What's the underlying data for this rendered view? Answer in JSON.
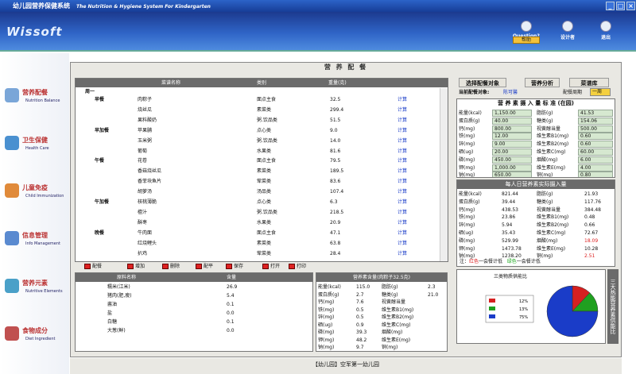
{
  "app": {
    "title_cn": "幼儿园营养保健系统",
    "title_en": "The Nutrition & Hygiene System For Kindergarten",
    "logo": "Wissoft",
    "colors": {
      "banner": "#2f64c6",
      "accent_red": "#cc2222",
      "calc_blue": "#1a3cc8"
    }
  },
  "banner_icons": [
    {
      "label": "Question?",
      "icon": "question-icon"
    },
    {
      "label": "设计者",
      "icon": "designer-icon"
    },
    {
      "label": "Exit\n退出",
      "icon": "exit-icon"
    }
  ],
  "help_label": "帮助",
  "sidebar": [
    {
      "cn": "营养配餐",
      "en": "Nutrition Balance",
      "icon": "food-icon"
    },
    {
      "cn": "卫生保健",
      "en": "Health Care",
      "icon": "doctor-icon"
    },
    {
      "cn": "儿童免疫",
      "en": "Child Immunization",
      "icon": "child-icon"
    },
    {
      "cn": "信息管理",
      "en": "Info Management",
      "icon": "info-icon"
    },
    {
      "cn": "营养元素",
      "en": "Nutritive Elements",
      "icon": "elements-icon"
    },
    {
      "cn": "食物成分",
      "en": "Diet Ingredient",
      "icon": "ingredient-icon"
    }
  ],
  "main": {
    "title": "营 养 配 餐"
  },
  "menu_table": {
    "headers": [
      "菜谱名称",
      "类别",
      "重量(克)"
    ],
    "day": "周一",
    "calc": "计算",
    "rows": [
      [
        "早餐",
        "肉粽子",
        "面点主食",
        "32.5"
      ],
      [
        "",
        "烧丝瓜",
        "素菜类",
        "299.4"
      ],
      [
        "",
        "果料酸奶",
        "粥.饮品类",
        "51.5"
      ],
      [
        "早加餐",
        "苹果脯",
        "点心类",
        "9.0"
      ],
      [
        "",
        "玉米粥",
        "粥.饮品类",
        "14.0"
      ],
      [
        "",
        "葡萄",
        "水果类",
        "81.6"
      ],
      [
        "午餐",
        "花卷",
        "面点主食",
        "79.5"
      ],
      [
        "",
        "香菇烧丝瓜",
        "素菜类",
        "189.5"
      ],
      [
        "",
        "香菲块鱼片",
        "荤菜类",
        "83.6"
      ],
      [
        "",
        "胡萝汤",
        "汤品类",
        "107.4"
      ],
      [
        "午加餐",
        "核桃薄脆",
        "点心类",
        "6.3"
      ],
      [
        "",
        "檀汁",
        "粥.饮品类",
        "218.5"
      ],
      [
        "",
        "酥枣",
        "水果类",
        "20.9"
      ],
      [
        "晚餐",
        "牛肉面",
        "面点主食",
        "47.1"
      ],
      [
        "",
        "红烧鲤头",
        "素菜类",
        "63.8"
      ],
      [
        "",
        "扒鸡",
        "荤菜类",
        "28.4"
      ]
    ]
  },
  "toolbar": [
    "配餐",
    "增加",
    "删除",
    "配平",
    "保存",
    "打开",
    "打印"
  ],
  "ingredient_table": {
    "headers": [
      "原料名称",
      "含量"
    ],
    "rows": [
      [
        "糯米(江米)",
        "26.9"
      ],
      [
        "猪肉(肥,瘦)",
        "5.4"
      ],
      [
        "酱油",
        "0.1"
      ],
      [
        "盐",
        "0.0"
      ],
      [
        "白糖",
        "0.1"
      ],
      [
        "大葱(鲜)",
        "0.0"
      ]
    ]
  },
  "dish_nutrients": {
    "title": "营养素含量(肉粽子32.5克)",
    "left": [
      [
        "能量(kcal)",
        "115.0"
      ],
      [
        "蛋白质(g)",
        "2.7"
      ],
      [
        "钙(mg)",
        "7.6"
      ],
      [
        "铁(mg)",
        "0.5"
      ],
      [
        "锌(mg)",
        "0.5"
      ],
      [
        "硒(ug)",
        "0.9"
      ],
      [
        "磷(mg)",
        "39.3"
      ],
      [
        "钾(mg)",
        "48.2"
      ],
      [
        "钠(mg)",
        "9.7"
      ]
    ],
    "right": [
      [
        "脂肪(g)",
        "2.3"
      ],
      [
        "糖类(g)",
        "21.0"
      ],
      [
        "视黄醇当量",
        ""
      ],
      [
        "维生素B1(mg)",
        ""
      ],
      [
        "维生素B2(mg)",
        ""
      ],
      [
        "维生素C(mg)",
        ""
      ],
      [
        "烟酸(mg)",
        ""
      ],
      [
        "维生素E(mg)",
        ""
      ],
      [
        "铜(mg)",
        ""
      ]
    ]
  },
  "right_buttons": [
    "选择配餐对象",
    "营养分析",
    "菜谱库"
  ],
  "target": {
    "label": "当前配餐对象:",
    "value": "陈可馨",
    "period_label": "配餐周期",
    "period": "一周"
  },
  "standard": {
    "title": "营 养 素 摄 入 量 标 准 (在园)",
    "left": [
      [
        "能量(kcal)",
        "1,150.00"
      ],
      [
        "蛋白质(g)",
        "40.00"
      ],
      [
        "钙(mg)",
        "800.00"
      ],
      [
        "铁(mg)",
        "12.00"
      ],
      [
        "锌(mg)",
        "9.00"
      ],
      [
        "硒(ug)",
        "20.00"
      ],
      [
        "磷(mg)",
        "450.00"
      ],
      [
        "钾(mg)",
        "1,000.00"
      ],
      [
        "钠(mg)",
        "650.00"
      ]
    ],
    "right": [
      [
        "脂肪(g)",
        "41.53"
      ],
      [
        "糖类(g)",
        "154.06"
      ],
      [
        "视黄醇当量",
        "500.00"
      ],
      [
        "维生素B1(mg)",
        "0.60"
      ],
      [
        "维生素B2(mg)",
        "0.60"
      ],
      [
        "维生素C(mg)",
        "60.00"
      ],
      [
        "烟酸(mg)",
        "6.00"
      ],
      [
        "维生素E(mg)",
        "4.00"
      ],
      [
        "铜(mg)",
        "0.80"
      ]
    ]
  },
  "actual": {
    "title": "每人日营养素实际摄入量",
    "left": [
      [
        "能量(kcal)",
        "821.44"
      ],
      [
        "蛋白质(g)",
        "39.44"
      ],
      [
        "钙(mg)",
        "438.53"
      ],
      [
        "铁(mg)",
        "23.86"
      ],
      [
        "锌(mg)",
        "5.94"
      ],
      [
        "硒(ug)",
        "35.43"
      ],
      [
        "磷(mg)",
        "529.99"
      ],
      [
        "钾(mg)",
        "1473.78"
      ],
      [
        "钠(mg)",
        "1238.20"
      ]
    ],
    "right": [
      [
        "脂肪(g)",
        "21.93"
      ],
      [
        "糖类(g)",
        "117.76"
      ],
      [
        "视黄醇当量",
        "384.48"
      ],
      [
        "维生素B1(mg)",
        "0.48"
      ],
      [
        "维生素B2(mg)",
        "0.66"
      ],
      [
        "维生素C(mg)",
        "72.67"
      ],
      [
        "烟酸(mg)",
        "18.09"
      ],
      [
        "维生素E(mg)",
        "10.28"
      ],
      [
        "铜(mg)",
        "2.51"
      ]
    ],
    "red_idx": [
      6,
      8
    ]
  },
  "legend": {
    "note": "注：",
    "red": "红色",
    "red_text": "一会餐计低",
    "green": "绿色",
    "green_text": "一会餐计低"
  },
  "chart": {
    "title": "三类物质供能比",
    "side_label": "三大热能营养素供能比"
  },
  "chart_data": {
    "type": "pie",
    "values": [
      12,
      13,
      75
    ],
    "colors": [
      "#d62020",
      "#20a020",
      "#1a3cc8"
    ],
    "labels": [
      "12%",
      "13%",
      "75%"
    ],
    "title": "三类物质供能比"
  },
  "status": "【幼儿园】空军第一幼儿园"
}
